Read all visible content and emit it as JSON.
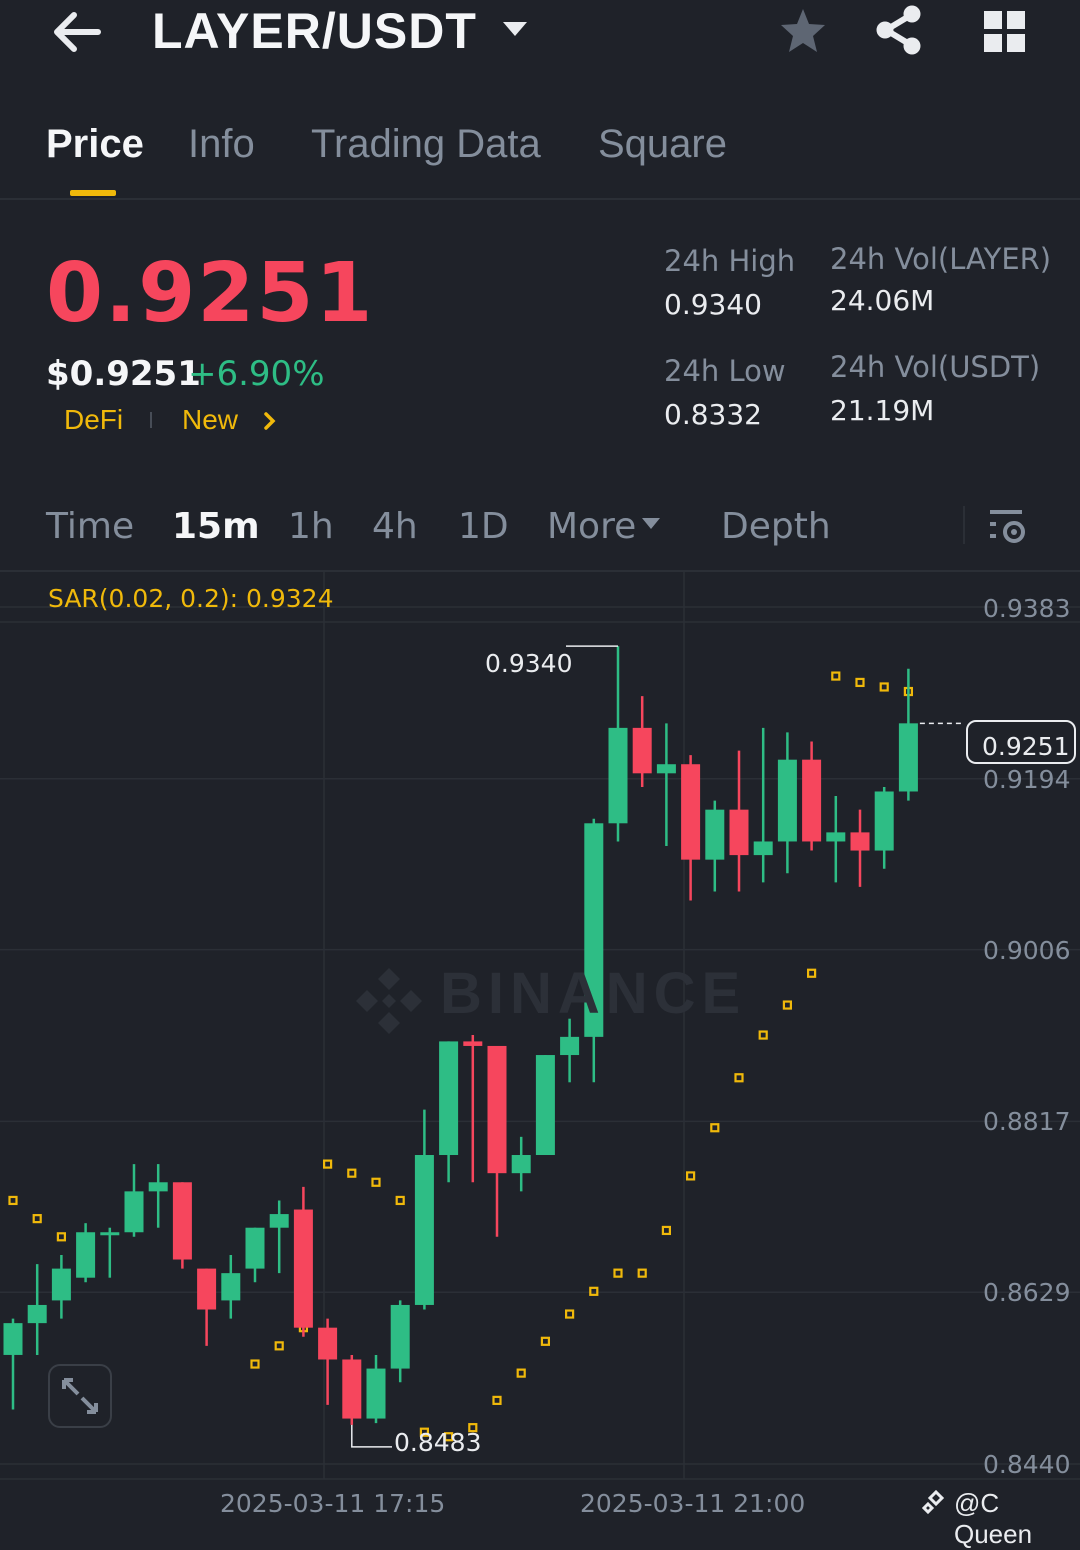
{
  "header": {
    "pair": "LAYER/USDT",
    "icons": [
      "back-arrow-icon",
      "caret-down-icon",
      "star-icon",
      "share-icon",
      "grid-icon"
    ]
  },
  "tabs": [
    {
      "label": "Price",
      "active": true
    },
    {
      "label": "Info"
    },
    {
      "label": "Trading Data"
    },
    {
      "label": "Square"
    }
  ],
  "price": {
    "last": "0.9251",
    "usd": "$0.9251",
    "change": "+6.90%",
    "tags": [
      "DeFi",
      "New"
    ]
  },
  "stats": {
    "high_label": "24h High",
    "high": "0.9340",
    "low_label": "24h Low",
    "low": "0.8332",
    "vol_base_label": "24h Vol(LAYER)",
    "vol_base": "24.06M",
    "vol_quote_label": "24h Vol(USDT)",
    "vol_quote": "21.19M"
  },
  "intervals": {
    "items": [
      "Time",
      "15m",
      "1h",
      "4h",
      "1D"
    ],
    "active": "15m",
    "more": "More",
    "depth": "Depth"
  },
  "chart": {
    "indicator": "SAR(0.02, 0.2): 0.9324",
    "y_ticks": [
      "0.9383",
      "0.9194",
      "0.9006",
      "0.8817",
      "0.8629",
      "0.8440"
    ],
    "x_ticks": [
      "2025-03-11 17:15",
      "2025-03-11 21:00"
    ],
    "current_price": "0.9251",
    "high_marker": "0.9340",
    "low_marker": "0.8483",
    "watermark": "BINANCE"
  },
  "credit": "@C Queen",
  "colors": {
    "up": "#2ebd85",
    "down": "#f6465d",
    "accent": "#f0b90b",
    "bg": "#1f2229"
  },
  "chart_data": {
    "type": "candlestick",
    "y_ticks": [
      0.9383,
      0.9194,
      0.9006,
      0.8817,
      0.8629,
      0.844
    ],
    "ylim": [
      0.8397,
      0.9491
    ],
    "x_ticks": [
      "2025-03-11 17:15",
      "2025-03-11 21:00"
    ],
    "candles": [
      {
        "o": 0.856,
        "h": 0.86,
        "l": 0.85,
        "c": 0.8595
      },
      {
        "o": 0.8595,
        "h": 0.866,
        "l": 0.856,
        "c": 0.8615
      },
      {
        "o": 0.862,
        "h": 0.867,
        "l": 0.86,
        "c": 0.8655
      },
      {
        "o": 0.8645,
        "h": 0.8705,
        "l": 0.864,
        "c": 0.8695
      },
      {
        "o": 0.8695,
        "h": 0.87,
        "l": 0.8645,
        "c": 0.8695
      },
      {
        "o": 0.8695,
        "h": 0.877,
        "l": 0.869,
        "c": 0.874
      },
      {
        "o": 0.874,
        "h": 0.877,
        "l": 0.87,
        "c": 0.875
      },
      {
        "o": 0.875,
        "h": 0.8725,
        "l": 0.8655,
        "c": 0.8665
      },
      {
        "o": 0.8655,
        "h": 0.863,
        "l": 0.857,
        "c": 0.861
      },
      {
        "o": 0.862,
        "h": 0.867,
        "l": 0.86,
        "c": 0.865
      },
      {
        "o": 0.8655,
        "h": 0.87,
        "l": 0.864,
        "c": 0.87
      },
      {
        "o": 0.87,
        "h": 0.873,
        "l": 0.865,
        "c": 0.8715
      },
      {
        "o": 0.872,
        "h": 0.8745,
        "l": 0.858,
        "c": 0.859
      },
      {
        "o": 0.859,
        "h": 0.86,
        "l": 0.8505,
        "c": 0.8555
      },
      {
        "o": 0.8555,
        "h": 0.856,
        "l": 0.8483,
        "c": 0.849
      },
      {
        "o": 0.849,
        "h": 0.856,
        "l": 0.8485,
        "c": 0.8545
      },
      {
        "o": 0.8545,
        "h": 0.862,
        "l": 0.853,
        "c": 0.8615
      },
      {
        "o": 0.8615,
        "h": 0.883,
        "l": 0.861,
        "c": 0.878
      },
      {
        "o": 0.878,
        "h": 0.886,
        "l": 0.875,
        "c": 0.8905
      },
      {
        "o": 0.8905,
        "h": 0.8912,
        "l": 0.875,
        "c": 0.89
      },
      {
        "o": 0.89,
        "h": 0.885,
        "l": 0.869,
        "c": 0.876
      },
      {
        "o": 0.876,
        "h": 0.88,
        "l": 0.874,
        "c": 0.878
      },
      {
        "o": 0.878,
        "h": 0.889,
        "l": 0.878,
        "c": 0.889
      },
      {
        "o": 0.889,
        "h": 0.893,
        "l": 0.886,
        "c": 0.891
      },
      {
        "o": 0.891,
        "h": 0.915,
        "l": 0.886,
        "c": 0.9145
      },
      {
        "o": 0.9145,
        "h": 0.934,
        "l": 0.9125,
        "c": 0.925
      },
      {
        "o": 0.925,
        "h": 0.9285,
        "l": 0.9185,
        "c": 0.92
      },
      {
        "o": 0.92,
        "h": 0.9255,
        "l": 0.912,
        "c": 0.921
      },
      {
        "o": 0.921,
        "h": 0.922,
        "l": 0.906,
        "c": 0.9105
      },
      {
        "o": 0.9105,
        "h": 0.917,
        "l": 0.907,
        "c": 0.916
      },
      {
        "o": 0.916,
        "h": 0.9225,
        "l": 0.907,
        "c": 0.911
      },
      {
        "o": 0.911,
        "h": 0.925,
        "l": 0.908,
        "c": 0.9125
      },
      {
        "o": 0.9125,
        "h": 0.9245,
        "l": 0.909,
        "c": 0.9215
      },
      {
        "o": 0.9215,
        "h": 0.9235,
        "l": 0.9115,
        "c": 0.9125
      },
      {
        "o": 0.9125,
        "h": 0.9175,
        "l": 0.908,
        "c": 0.9135
      },
      {
        "o": 0.9135,
        "h": 0.916,
        "l": 0.9075,
        "c": 0.9115
      },
      {
        "o": 0.9115,
        "h": 0.9185,
        "l": 0.9095,
        "c": 0.918
      },
      {
        "o": 0.918,
        "h": 0.9315,
        "l": 0.917,
        "c": 0.9255
      }
    ],
    "sar": [
      0.873,
      0.871,
      0.869,
      null,
      null,
      null,
      null,
      null,
      null,
      null,
      0.855,
      0.857,
      0.859,
      0.877,
      0.876,
      0.875,
      0.873,
      0.8475,
      0.847,
      0.848,
      0.851,
      0.854,
      0.8575,
      0.8605,
      0.863,
      0.865,
      0.865,
      0.8697,
      0.8757,
      0.881,
      0.8865,
      0.8912,
      0.8945,
      0.898,
      0.9307,
      0.93,
      0.9295,
      0.929
    ]
  }
}
